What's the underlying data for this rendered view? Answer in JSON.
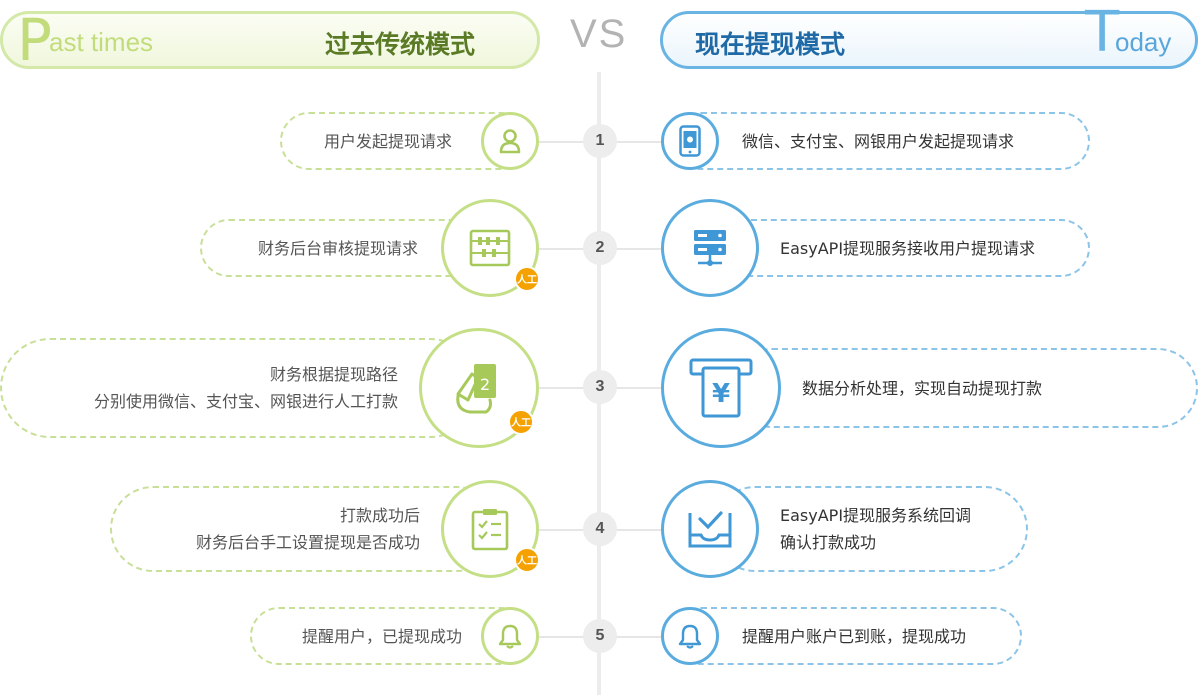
{
  "header": {
    "left": {
      "letter": "P",
      "sub": "ast times",
      "title": "过去传统模式"
    },
    "vs": "VS",
    "right": {
      "title": "现在提现模式",
      "letter": "T",
      "sub": "oday"
    }
  },
  "badge": "人工",
  "colors": {
    "past_green": "#c4df86",
    "today_blue": "#5aacdf",
    "badge_orange": "#f5a200"
  },
  "steps": [
    {
      "num": "1",
      "past": {
        "lines": [
          "用户发起提现请求"
        ],
        "icon": "user-icon",
        "manual": false
      },
      "today": {
        "lines": [
          "微信、支付宝、网银用户发起提现请求"
        ],
        "icon": "mobile-phone-icon"
      }
    },
    {
      "num": "2",
      "past": {
        "lines": [
          "财务后台审核提现请求"
        ],
        "icon": "abacus-icon",
        "manual": true
      },
      "today": {
        "lines": [
          "EasyAPI提现服务接收用户提现请求"
        ],
        "icon": "server-icon"
      }
    },
    {
      "num": "3",
      "past": {
        "lines": [
          "财务根据提现路径",
          "分别使用微信、支付宝、网银进行人工打款"
        ],
        "icon": "hand-card-icon",
        "manual": true
      },
      "today": {
        "lines": [
          "数据分析处理，实现自动提现打款"
        ],
        "icon": "atm-yuan-icon"
      }
    },
    {
      "num": "4",
      "past": {
        "lines": [
          "打款成功后",
          "财务后台手工设置提现是否成功"
        ],
        "icon": "clipboard-check-icon",
        "manual": true
      },
      "today": {
        "lines": [
          "EasyAPI提现服务系统回调",
          "确认打款成功"
        ],
        "icon": "tray-check-icon"
      }
    },
    {
      "num": "5",
      "past": {
        "lines": [
          "提醒用户，已提现成功"
        ],
        "icon": "bell-icon",
        "manual": false
      },
      "today": {
        "lines": [
          "提醒用户账户已到账，提现成功"
        ],
        "icon": "bell-icon"
      }
    }
  ]
}
